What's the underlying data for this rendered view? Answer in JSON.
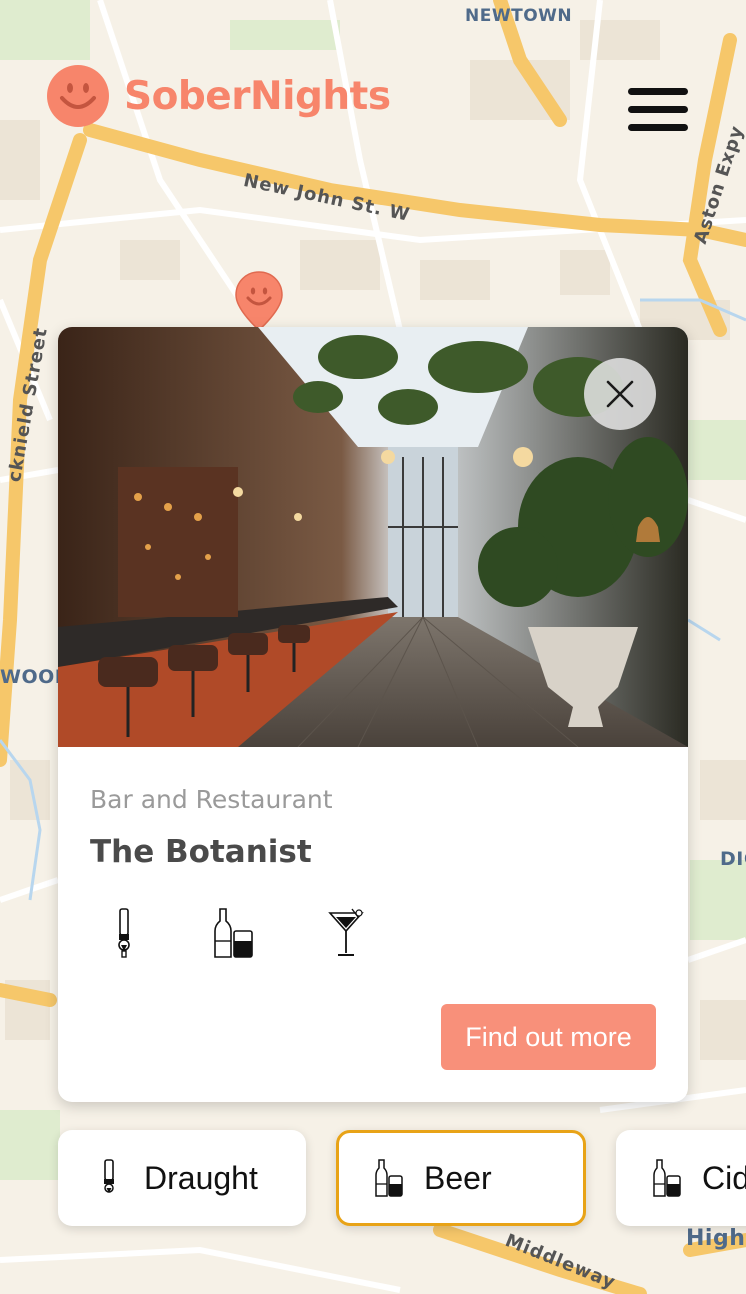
{
  "app": {
    "brand": "SoberNights",
    "brand_color": "#f7856b",
    "menu_icon": "hamburger-menu-icon"
  },
  "map": {
    "labels": {
      "area_top": "NEWTOWN",
      "street_main": "New John St. W",
      "street_right": "Aston Expy",
      "street_left": "cknield Street",
      "area_left": "WOOD",
      "area_right": "DIG",
      "street_bottom": "Middleway",
      "street_bottom_right": "High"
    }
  },
  "venue_card": {
    "category": "Bar and Restaurant",
    "name": "The Botanist",
    "photo_alt": "Bar interior photo",
    "close_icon": "close-icon",
    "drink_icons": [
      "draught-tap-icon",
      "beer-bottle-icon",
      "cocktail-glass-icon"
    ],
    "cta_label": "Find out more",
    "cta_color": "#f8907a"
  },
  "filters": [
    {
      "label": "Draught",
      "icon": "draught-tap-icon",
      "active": false
    },
    {
      "label": "Beer",
      "icon": "beer-bottle-icon",
      "active": true
    },
    {
      "label": "Cid",
      "icon": "cider-bottle-icon",
      "active": false
    }
  ],
  "filter_active_color": "#e8a317"
}
